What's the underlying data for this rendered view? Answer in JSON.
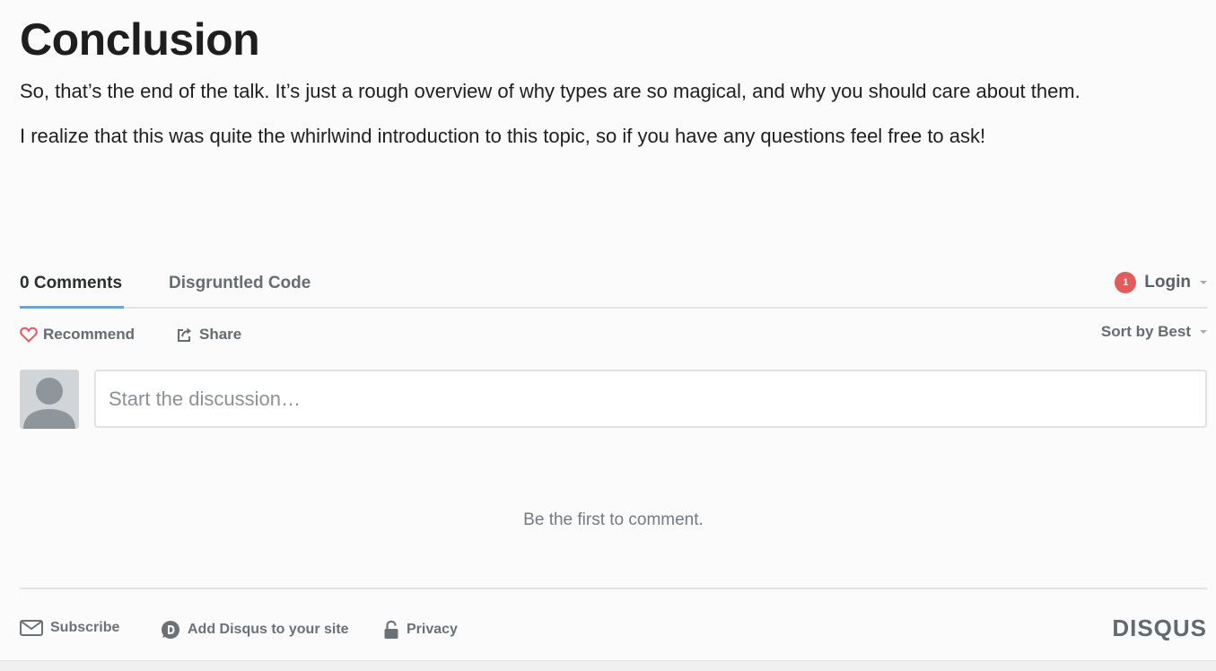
{
  "article": {
    "heading": "Conclusion",
    "paragraph_1": "So, that’s the end of the talk. It’s just a rough overview of why types are so magical, and why you should care about them.",
    "paragraph_2": "I realize that this was quite the whirlwind introduction to this topic, so if you have any questions feel free to ask!"
  },
  "comments": {
    "tabs": [
      {
        "label": "0 Comments",
        "active": true
      },
      {
        "label": "Disgruntled Code",
        "active": false
      }
    ],
    "login": {
      "badge": "1",
      "label": "Login"
    },
    "actions": {
      "recommend": "Recommend",
      "share": "Share",
      "sort": "Sort by Best"
    },
    "composer": {
      "placeholder": "Start the discussion…"
    },
    "empty_message": "Be the first to comment."
  },
  "footer": {
    "subscribe": "Subscribe",
    "add_disqus": "Add Disqus to your site",
    "privacy": "Privacy",
    "brand": "DISQUS"
  },
  "colors": {
    "accent_tab": "#2e9fff",
    "badge": "#e55a5a",
    "heart": "#e55a5a"
  },
  "icons": [
    "heart-icon",
    "share-icon",
    "user-avatar-icon",
    "mail-icon",
    "disqus-logo-icon",
    "lock-icon",
    "chevron-down-icon"
  ]
}
